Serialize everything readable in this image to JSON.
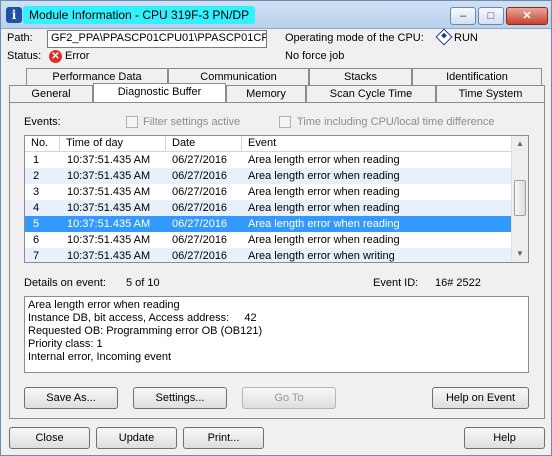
{
  "window": {
    "title": "Module Information - CPU 319F-3 PN/DP",
    "controls": {
      "minimize": "–",
      "maximize": "□",
      "close": "✕"
    }
  },
  "info": {
    "path_label": "Path:",
    "path_value": "GF2_PPA\\PPASCP01CPU01\\PPASCP01CF",
    "status_label": "Status:",
    "status_value": "Error",
    "mode_label": "Operating mode of the  CPU:",
    "mode_value": "RUN",
    "force_value": "No force job"
  },
  "tabs": {
    "row1": [
      "Performance Data",
      "Communication",
      "Stacks",
      "Identification"
    ],
    "row2": [
      "General",
      "Diagnostic Buffer",
      "Memory",
      "Scan Cycle Time",
      "Time System"
    ],
    "active": "Diagnostic Buffer"
  },
  "filters": {
    "events_label": "Events:",
    "filter_active": "Filter settings active",
    "cpu_time": "Time including CPU/local time difference"
  },
  "table": {
    "columns": [
      "No.",
      "Time of day",
      "Date",
      "Event"
    ],
    "rows": [
      {
        "no": "1",
        "time": "10:37:51.435 AM",
        "date": "06/27/2016",
        "event": "Area length error when reading"
      },
      {
        "no": "2",
        "time": "10:37:51.435 AM",
        "date": "06/27/2016",
        "event": "Area length error when reading"
      },
      {
        "no": "3",
        "time": "10:37:51.435 AM",
        "date": "06/27/2016",
        "event": "Area length error when reading"
      },
      {
        "no": "4",
        "time": "10:37:51.435 AM",
        "date": "06/27/2016",
        "event": "Area length error when reading"
      },
      {
        "no": "5",
        "time": "10:37:51.435 AM",
        "date": "06/27/2016",
        "event": "Area length error when reading"
      },
      {
        "no": "6",
        "time": "10:37:51.435 AM",
        "date": "06/27/2016",
        "event": "Area length error when reading"
      },
      {
        "no": "7",
        "time": "10:37:51.435 AM",
        "date": "06/27/2016",
        "event": "Area length error when writing"
      }
    ],
    "selected_index": 4
  },
  "details": {
    "label": "Details on event:",
    "position": "5 of 10",
    "event_id_label": "Event ID:",
    "event_id": "16# 2522",
    "lines": [
      "Area length error when reading",
      "Instance DB, bit access, Access address:     42",
      "Requested OB: Programming error OB (OB121)",
      "Priority class:  1",
      "Internal error, Incoming event"
    ]
  },
  "buttons": {
    "save_as": "Save As...",
    "settings": "Settings...",
    "go_to": "Go To",
    "help_on_event": "Help on Event",
    "close": "Close",
    "update": "Update",
    "print": "Print...",
    "help": "Help"
  },
  "colors": {
    "title_highlight": "#33f0ff",
    "selection": "#3399ff",
    "alt_row": "#e8f1fb"
  }
}
